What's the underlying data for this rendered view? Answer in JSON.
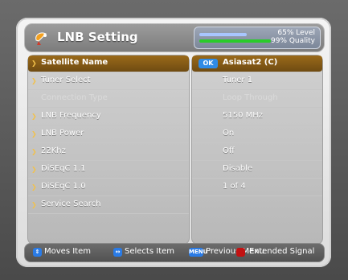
{
  "title": "LNB Setting",
  "signal": {
    "level_text": "65% Level",
    "quality_text": "99% Quality",
    "level": 0.65,
    "quality": 0.99
  },
  "menu": {
    "items": [
      "Satellite Name",
      "Tuner Select",
      "Connection Type",
      "LNB Frequency",
      "LNB Power",
      "22Khz",
      "DiSEqC 1.1",
      "DiSEqC 1.0",
      "Service Search"
    ],
    "values": [
      "Asiasat2 (C)",
      "Tuner 1",
      "Loop Through",
      "5150 MHz",
      "On",
      "Off",
      "Disable",
      "1 of 4",
      ""
    ],
    "ok_label": "OK"
  },
  "help": {
    "moves": "Moves Item",
    "selects": "Selects Item",
    "menu_label": "MENU",
    "previous": "Previous Menu",
    "extended": "Extended Signal"
  },
  "colors": {
    "selected_row": "#8a5d17",
    "ok_badge": "#2f8be6",
    "quality_bar": "#2acb2a",
    "level_bar": "#a8c6ff",
    "help_red": "#c21212"
  },
  "icons": {
    "title": "satellite-dish-icon"
  }
}
